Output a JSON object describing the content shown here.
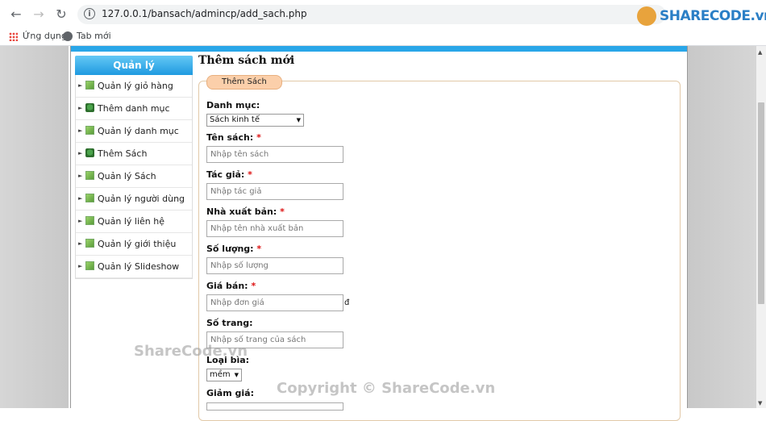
{
  "browser": {
    "url": "127.0.0.1/bansach/admincp/add_sach.php",
    "bookmarks": [
      "Ứng dụng",
      "Tab mới"
    ],
    "logo_text": "SHARECODE.vn"
  },
  "sidebar": {
    "header": "Quản lý",
    "items": [
      {
        "label": "Quản lý giỏ hàng",
        "icon": "book-icon"
      },
      {
        "label": "Thêm danh mục",
        "icon": "add-icon"
      },
      {
        "label": "Quản lý danh mục",
        "icon": "book-icon"
      },
      {
        "label": "Thêm Sách",
        "icon": "add-icon"
      },
      {
        "label": "Quản lý Sách",
        "icon": "book-icon"
      },
      {
        "label": "Quản lý người dùng",
        "icon": "book-icon"
      },
      {
        "label": "Quản lý liên hệ",
        "icon": "book-icon"
      },
      {
        "label": "Quản lý giới thiệu",
        "icon": "book-icon"
      },
      {
        "label": "Quản lý Slideshow",
        "icon": "book-icon"
      }
    ]
  },
  "main": {
    "title": "Thêm sách mới",
    "legend": "Thêm Sách",
    "category_label": "Danh mục:",
    "category_value": "Sách kinh tế",
    "name_label": "Tên sách:",
    "name_placeholder": "Nhập tên sách",
    "author_label": "Tác giả:",
    "author_placeholder": "Nhập tác giả",
    "publisher_label": "Nhà xuất bản:",
    "publisher_placeholder": "Nhập tên nhà xuất bản",
    "quantity_label": "Số lượng:",
    "quantity_placeholder": "Nhập số lượng",
    "price_label": "Giá bán:",
    "price_placeholder": "Nhập đơn giá",
    "price_unit": "đ",
    "pages_label": "Số trang:",
    "pages_placeholder": "Nhập số trang của sách",
    "cover_label": "Loại bìa:",
    "cover_value": "mềm",
    "discount_label": "Giảm giá:",
    "required_mark": "*"
  },
  "watermarks": {
    "left": "ShareCode.vn",
    "bottom": "Copyright © ShareCode.vn"
  }
}
